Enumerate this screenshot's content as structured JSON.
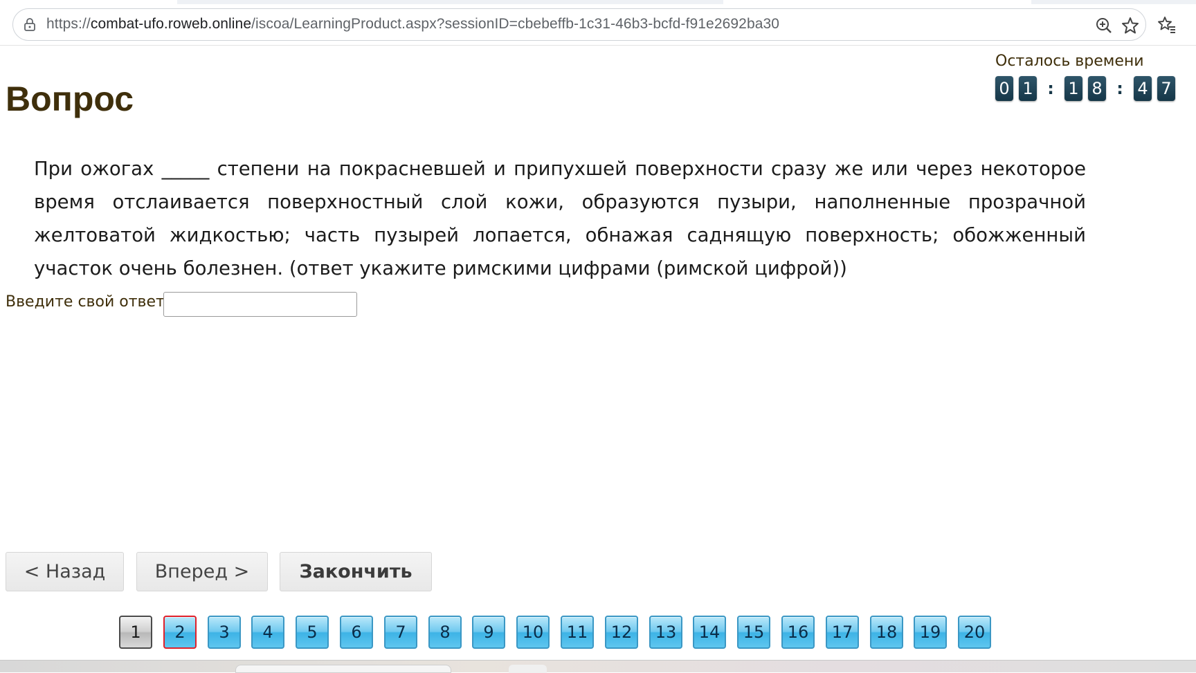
{
  "browser": {
    "url_prefix": "https://",
    "url_domain": "combat-ufo.roweb.online",
    "url_path": "/iscoa/LearningProduct.aspx?sessionID=cbebeffb-1c31-46b3-bcfd-f91e2692ba30",
    "icons": [
      "lock-icon",
      "zoom-icon",
      "bookmark-star-icon",
      "favorites-icon"
    ]
  },
  "page": {
    "title": "Вопрос",
    "timer_label": "Осталось времени",
    "timer": {
      "h1": "0",
      "h2": "1",
      "sep1": ":",
      "m1": "1",
      "m2": "8",
      "sep2": ":",
      "s1": "4",
      "s2": "7"
    },
    "question": "При ожогах _____ степени на покрасневшей и припухшей поверхности сразу же или через некоторое время отслаивается поверхностный слой кожи, образуются пузыри, наполненные прозрачной желтоватой жидкостью; часть пузырей лопается, обнажая саднящую поверхность; обожженный участок очень болезнен. (ответ укажите римскими цифрами (римской цифрой))",
    "answer_label": "Введите свой ответ",
    "answer_value": "",
    "buttons": {
      "back": "< Назад",
      "forward": "Вперед >",
      "finish": "Закончить"
    },
    "pager": [
      "1",
      "2",
      "3",
      "4",
      "5",
      "6",
      "7",
      "8",
      "9",
      "10",
      "11",
      "12",
      "13",
      "14",
      "15",
      "16",
      "17",
      "18",
      "19",
      "20"
    ],
    "pager_done": "1",
    "pager_current": "2"
  },
  "colors": {
    "title": "#3f2f0b",
    "timer_digit": "#163748",
    "page_button": "#6fc9ef",
    "current_border": "#e0202a"
  }
}
